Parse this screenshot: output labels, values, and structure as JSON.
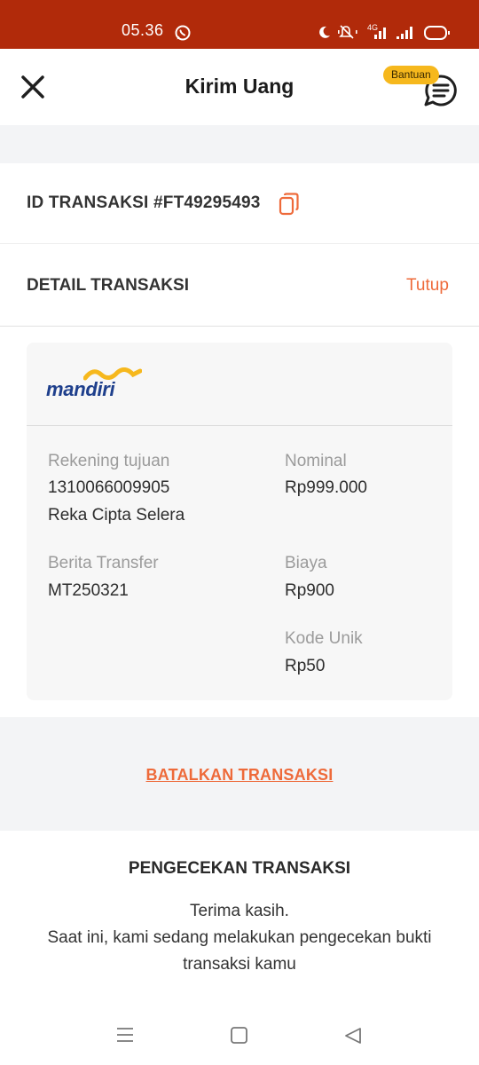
{
  "status_bar": {
    "time": "05.36",
    "network": "4G",
    "icons": [
      "whatsapp-icon",
      "moon-icon",
      "mute-icon",
      "signal-icon",
      "battery-icon"
    ]
  },
  "header": {
    "title": "Kirim Uang",
    "help_badge": "Bantuan",
    "icons": [
      "close-icon",
      "chat-icon"
    ]
  },
  "transaction": {
    "id_label": "ID TRANSAKSI #FT49295493"
  },
  "detail": {
    "title": "DETAIL TRANSAKSI",
    "close_link": "Tutup"
  },
  "card": {
    "bank_logo_text": "mandiri",
    "recipient_label": "Rekening tujuan",
    "recipient_account": "1310066009905",
    "recipient_name": "Reka Cipta Selera",
    "nominal_label": "Nominal",
    "nominal_value": "Rp999.000",
    "message_label": "Berita Transfer",
    "message_value": "MT250321",
    "fee_label": "Biaya",
    "fee_value": "Rp900",
    "unique_code_label": "Kode Unik",
    "unique_code_value": "Rp50"
  },
  "actions": {
    "cancel_label": "BATALKAN TRANSAKSI"
  },
  "check": {
    "title": "PENGECEKAN TRANSAKSI",
    "line1": "Terima kasih.",
    "line2": "Saat ini, kami sedang melakukan pengecekan bukti transaksi kamu"
  },
  "colors": {
    "status_bar": "#b12a0a",
    "accent": "#ee6a3a",
    "badge": "#f6b81d",
    "mandiri_blue": "#1e3f8c",
    "mandiri_gold": "#f6b81d"
  }
}
